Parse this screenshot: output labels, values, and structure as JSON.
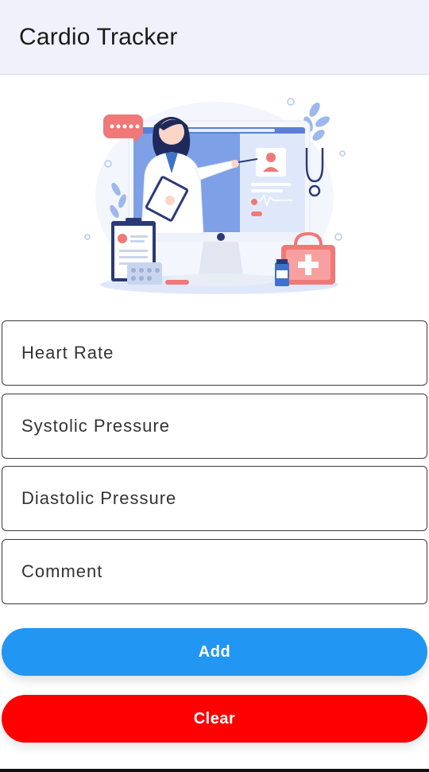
{
  "app": {
    "title": "Cardio Tracker"
  },
  "form": {
    "heart_rate_placeholder": "Heart Rate",
    "systolic_placeholder": "Systolic Pressure",
    "diastolic_placeholder": "Diastolic Pressure",
    "comment_placeholder": "Comment"
  },
  "buttons": {
    "add_label": "Add",
    "clear_label": "Clear"
  },
  "colors": {
    "add_button": "#2196f3",
    "clear_button": "#ff0000",
    "app_bar": "#f1f1fb"
  }
}
